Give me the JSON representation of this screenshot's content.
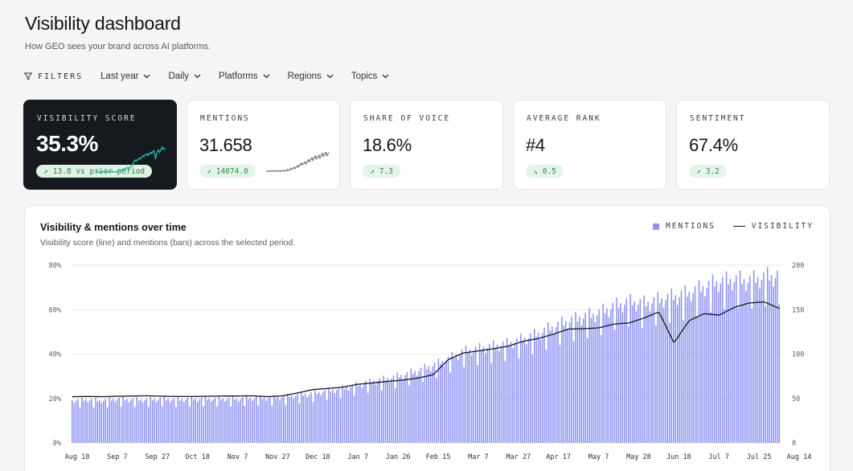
{
  "header": {
    "title": "Visibility dashboard",
    "subtitle": "How GEO sees your brand across AI platforms."
  },
  "filters": {
    "label": "FILTERS",
    "items": [
      "Last year",
      "Daily",
      "Platforms",
      "Regions",
      "Topics"
    ]
  },
  "cards": [
    {
      "label": "VISIBILITY SCORE",
      "value": "35.3%",
      "delta": "13.8 vs prior period",
      "direction": "up",
      "selected": true
    },
    {
      "label": "MENTIONS",
      "value": "31.658",
      "delta": "14074.0",
      "direction": "up"
    },
    {
      "label": "SHARE OF VOICE",
      "value": "18.6%",
      "delta": "7.3",
      "direction": "up"
    },
    {
      "label": "AVERAGE RANK",
      "value": "#4",
      "delta": "0.5",
      "direction": "down"
    },
    {
      "label": "SENTIMENT",
      "value": "67.4%",
      "delta": "3.2",
      "direction": "up"
    }
  ],
  "colors": {
    "bar": "#8b90f3",
    "line": "#16181d",
    "accent_teal": "#1fb5a8",
    "positive": "#2f8a4b",
    "dark_card": "#16191d"
  },
  "panel": {
    "title": "Visibility & mentions over time",
    "subtitle": "Visibility score (line) and mentions (bars) across the selected period.",
    "legend": {
      "bars": "MENTIONS",
      "line": "VISIBILITY"
    }
  },
  "chart_data": {
    "type": "bar",
    "title": "Visibility & mentions over time",
    "x_tick_labels": [
      "Aug 18",
      "Sep 7",
      "Sep 27",
      "Oct 18",
      "Nov 7",
      "Nov 27",
      "Dec 18",
      "Jan 7",
      "Jan 26",
      "Feb 15",
      "Mar 7",
      "Mar 27",
      "Apr 17",
      "May 7",
      "May 28",
      "Jun 18",
      "Jul 7",
      "Jul 25",
      "Aug 14"
    ],
    "y_left_ticks": [
      "0%",
      "20%",
      "40%",
      "60%",
      "80%"
    ],
    "y_right_ticks": [
      "0",
      "50",
      "100",
      "150",
      "200"
    ],
    "y_left_range": [
      0,
      80
    ],
    "y_right_range": [
      0,
      200
    ],
    "grid": true,
    "legend_position": "top-right",
    "series": [
      {
        "name": "MENTIONS",
        "kind": "bar",
        "axis": "right",
        "weekly_values": [
          48,
          49,
          48,
          50,
          49,
          49,
          50,
          49,
          50,
          50,
          50,
          50,
          51,
          51,
          52,
          54,
          56,
          59,
          62,
          66,
          70,
          73,
          77,
          82,
          88,
          95,
          104,
          107,
          110,
          113,
          118,
          124,
          132,
          138,
          143,
          147,
          155,
          160,
          158,
          162,
          166,
          170,
          177,
          183,
          185,
          184,
          188,
          190
        ],
        "note": "daily bars follow a weekly pattern around these levels"
      },
      {
        "name": "VISIBILITY",
        "kind": "line",
        "axis": "left",
        "weekly_values": [
          20.8,
          20.9,
          20.8,
          21.0,
          21.1,
          21.2,
          21.0,
          20.9,
          20.9,
          21.0,
          21.1,
          21.1,
          21.2,
          20.8,
          21.2,
          22.5,
          24.0,
          24.5,
          25.1,
          26.4,
          27.0,
          27.7,
          28.3,
          29.2,
          30.7,
          37.5,
          40.5,
          41.4,
          42.4,
          43.6,
          45.8,
          47.0,
          49.0,
          51.3,
          51.4,
          51.8,
          53.5,
          54.0,
          56.2,
          59.0,
          45.0,
          55.0,
          58.2,
          57.5,
          61.0,
          63.0,
          63.5,
          60.5
        ]
      }
    ]
  }
}
